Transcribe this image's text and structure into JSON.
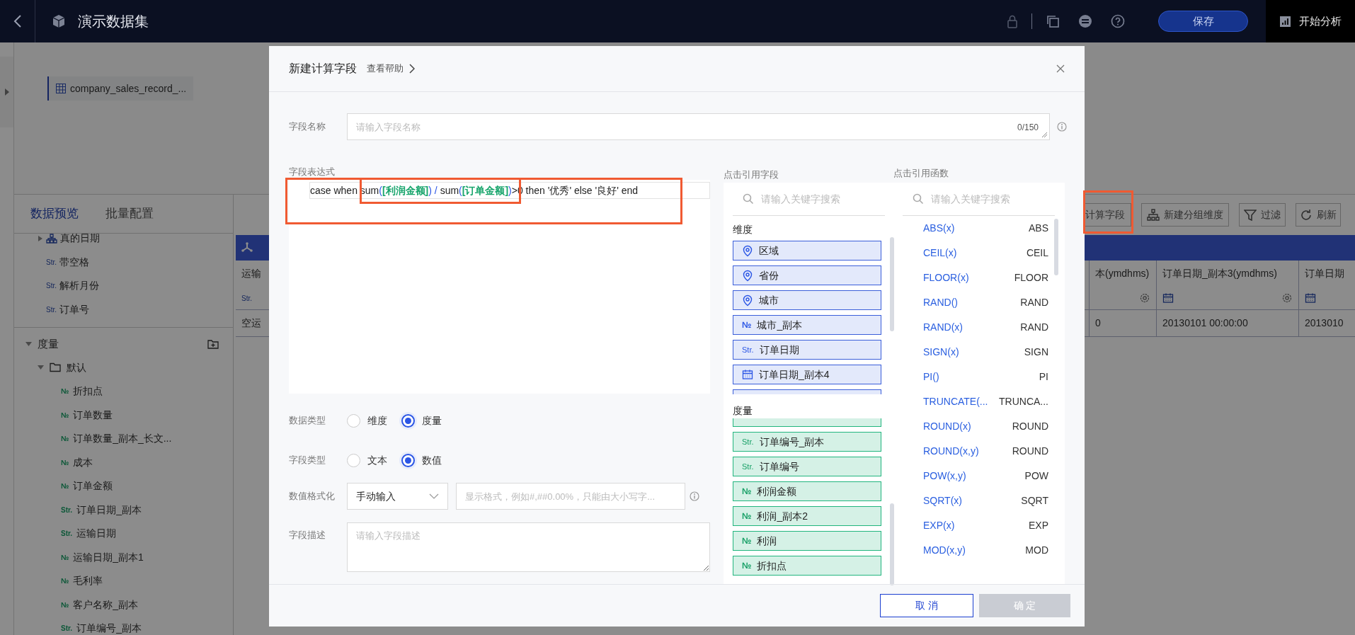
{
  "top_bar": {
    "title": "演示数据集",
    "save_button": "保存",
    "analyze_button": "开始分析"
  },
  "source_table": {
    "label": "company_sales_record_..."
  },
  "panel_tabs": [
    {
      "label": "数据预览",
      "selected": true
    },
    {
      "label": "批量配置",
      "selected": false
    }
  ],
  "dimension_fields": [
    {
      "kind": "hierarchy",
      "label": "真的日期",
      "expanded": false
    },
    {
      "kind": "string",
      "prefix": "Str.",
      "label": "带空格"
    },
    {
      "kind": "string",
      "prefix": "Str.",
      "label": "解析月份"
    },
    {
      "kind": "string",
      "prefix": "Str.",
      "label": "订单号"
    }
  ],
  "measures": {
    "title": "度量",
    "expanded": true,
    "folder": {
      "label": "默认",
      "expanded": true,
      "children": [
        {
          "prefix": "№",
          "label": "折扣点"
        },
        {
          "prefix": "№",
          "label": "订单数量"
        },
        {
          "prefix": "№",
          "label": "订单数量_副本_长文..."
        },
        {
          "prefix": "№",
          "label": "成本"
        },
        {
          "prefix": "№",
          "label": "订单金额"
        },
        {
          "prefix": "Str.",
          "label": "订单日期_副本"
        },
        {
          "prefix": "Str.",
          "label": "运输日期"
        },
        {
          "prefix": "№",
          "label": "运输日期_副本1"
        },
        {
          "prefix": "№",
          "label": "毛利率"
        },
        {
          "prefix": "№",
          "label": "客户名称_副本"
        },
        {
          "prefix": "Str.",
          "label": "订单编号_副本"
        }
      ]
    }
  },
  "toolbar": [
    {
      "kind": "calc",
      "label": "计算字段"
    },
    {
      "kind": "group",
      "label": "新建分组维度"
    },
    {
      "kind": "filter",
      "label": "过滤"
    },
    {
      "kind": "refresh",
      "label": "刷新"
    }
  ],
  "table": {
    "columns": [
      {
        "kind": "string",
        "label": "运输",
        "prefix": "Str."
      },
      {
        "kind": "plain",
        "label": "本(ymdhms)",
        "settings": true
      },
      {
        "kind": "date",
        "label": "订单日期_副本3(ymdhms)",
        "settings": true
      },
      {
        "kind": "date",
        "label": "订单日期"
      }
    ],
    "rows": [
      [
        "空运",
        "0",
        "20130101 00:00:00",
        "2013010"
      ]
    ]
  },
  "dialog": {
    "title": "新建计算字段",
    "help_link": "查看帮助",
    "name_field": {
      "label": "字段名称",
      "placeholder": "请输入字段名称",
      "counter": "0/150"
    },
    "expression": {
      "label": "字段表达式",
      "tokens": [
        {
          "kind": "plain",
          "text": "case when "
        },
        {
          "kind": "plain",
          "text": "sum"
        },
        {
          "kind": "op",
          "text": "("
        },
        {
          "kind": "field",
          "text": "[利润金额]"
        },
        {
          "kind": "op",
          "text": ") / "
        },
        {
          "kind": "plain",
          "text": "sum"
        },
        {
          "kind": "op",
          "text": "("
        },
        {
          "kind": "field",
          "text": "[订单金额]"
        },
        {
          "kind": "op",
          "text": ")"
        },
        {
          "kind": "plain",
          "text": ">0 then '优秀' else '良好' end"
        }
      ]
    },
    "data_type": {
      "label": "数据类型",
      "options": [
        {
          "label": "维度",
          "selected": false
        },
        {
          "label": "度量",
          "selected": true
        }
      ]
    },
    "field_type": {
      "label": "字段类型",
      "options": [
        {
          "label": "文本",
          "selected": false
        },
        {
          "label": "数值",
          "selected": true
        }
      ]
    },
    "number_format": {
      "label": "数值格式化",
      "mode": "手动输入",
      "placeholder": "显示格式，例如#,##0.00%，只能由大小写字..."
    },
    "description": {
      "label": "字段描述",
      "placeholder": "请输入字段描述"
    },
    "field_picker": {
      "title": "点击引用字段",
      "search_placeholder": "请输入关键字搜索",
      "groups": [
        {
          "kind": "dimension",
          "title": "维度",
          "items": [
            {
              "kind": "geo",
              "label": "区域"
            },
            {
              "kind": "geo",
              "label": "省份"
            },
            {
              "kind": "geo",
              "label": "城市"
            },
            {
              "kind": "number",
              "prefix": "№",
              "label": "城市_副本"
            },
            {
              "kind": "string",
              "prefix": "Str.",
              "label": "订单日期"
            },
            {
              "kind": "date",
              "label": "订单日期_副本4"
            }
          ]
        },
        {
          "kind": "measure",
          "title": "度量",
          "items": [
            {
              "kind": "string",
              "prefix": "Str.",
              "label": "订单编号_副本"
            },
            {
              "kind": "string",
              "prefix": "Str.",
              "label": "订单编号"
            },
            {
              "kind": "number",
              "prefix": "№",
              "label": "利润金额"
            },
            {
              "kind": "number",
              "prefix": "№",
              "label": "利润_副本2"
            },
            {
              "kind": "number",
              "prefix": "№",
              "label": "利润"
            },
            {
              "kind": "number",
              "prefix": "№",
              "label": "折扣点"
            }
          ]
        }
      ]
    },
    "function_picker": {
      "title": "点击引用函数",
      "search_placeholder": "请输入关键字搜索",
      "functions": [
        {
          "signature": "ABS(x)",
          "name": "ABS"
        },
        {
          "signature": "CEIL(x)",
          "name": "CEIL"
        },
        {
          "signature": "FLOOR(x)",
          "name": "FLOOR"
        },
        {
          "signature": "RAND()",
          "name": "RAND"
        },
        {
          "signature": "RAND(x)",
          "name": "RAND"
        },
        {
          "signature": "SIGN(x)",
          "name": "SIGN"
        },
        {
          "signature": "PI()",
          "name": "PI"
        },
        {
          "signature": "TRUNCATE(...",
          "name": "TRUNCA..."
        },
        {
          "signature": "ROUND(x)",
          "name": "ROUND"
        },
        {
          "signature": "ROUND(x,y)",
          "name": "ROUND"
        },
        {
          "signature": "POW(x,y)",
          "name": "POW"
        },
        {
          "signature": "SQRT(x)",
          "name": "SQRT"
        },
        {
          "signature": "EXP(x)",
          "name": "EXP"
        },
        {
          "signature": "MOD(x,y)",
          "name": "MOD"
        }
      ]
    },
    "buttons": [
      {
        "kind": "cancel",
        "label": "取 消",
        "disabled": false
      },
      {
        "kind": "confirm",
        "label": "确 定",
        "disabled": true
      }
    ]
  }
}
